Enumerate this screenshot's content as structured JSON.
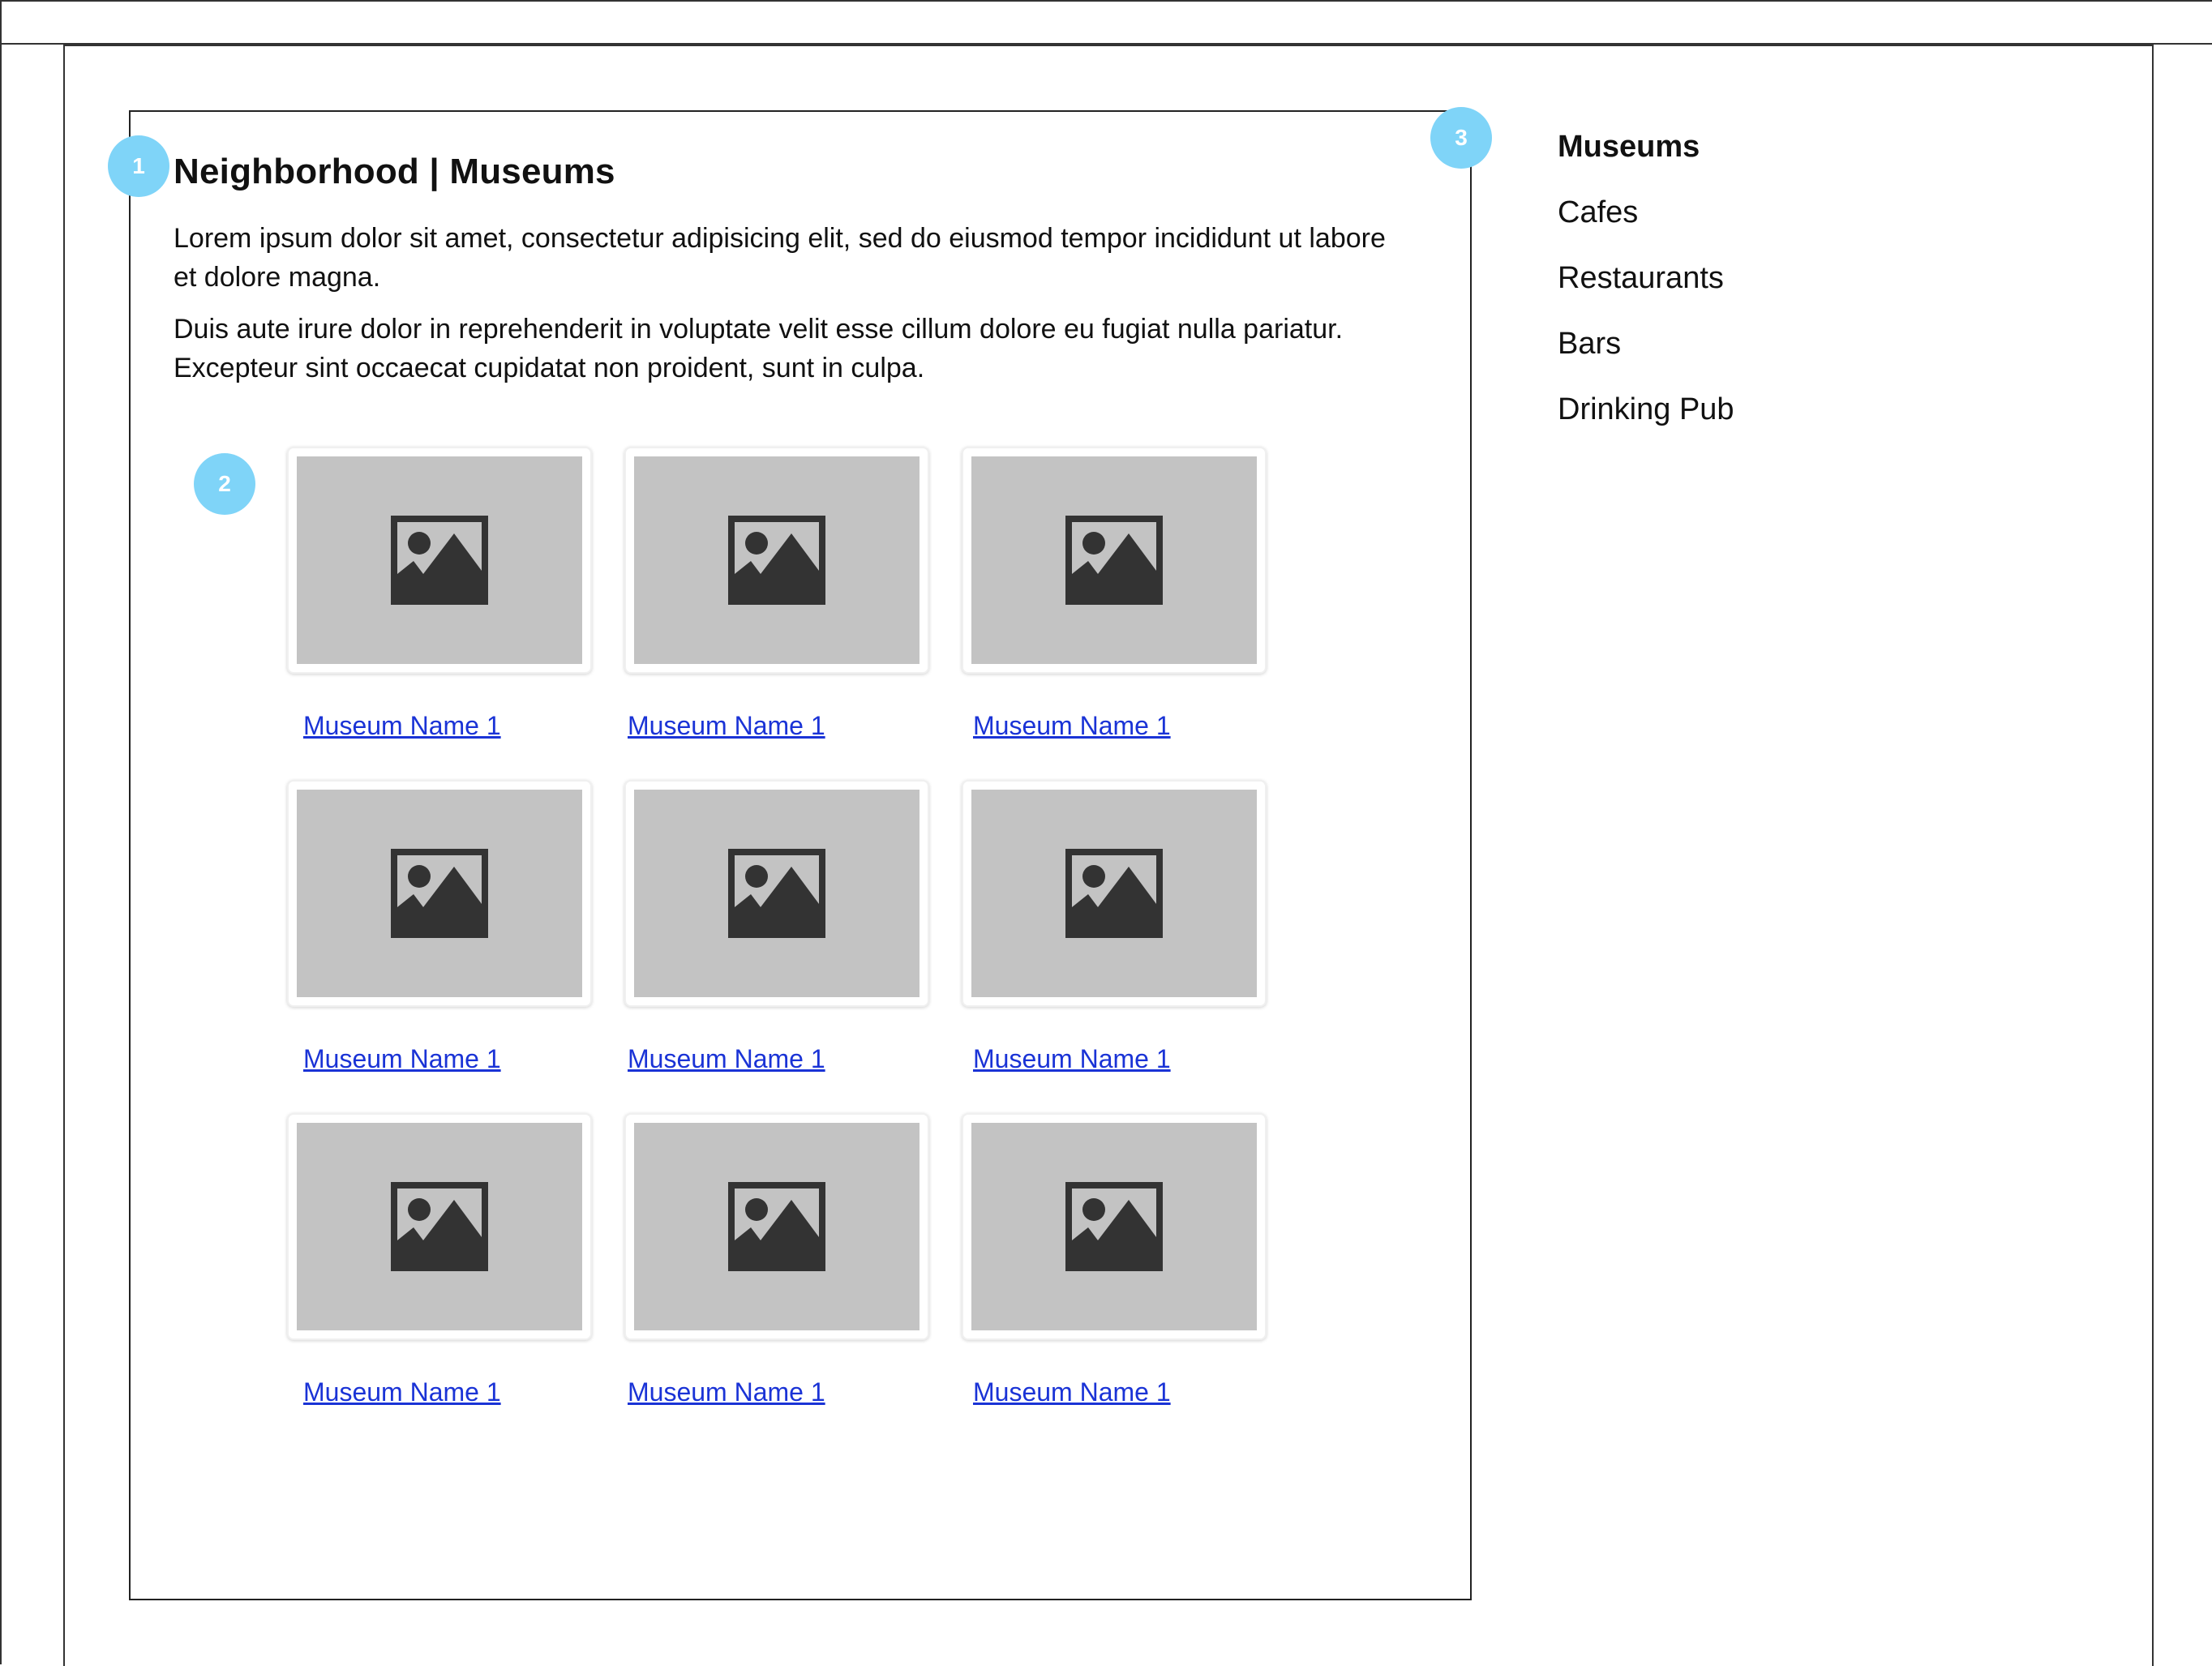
{
  "annotations": {
    "badge_1": "1",
    "badge_2": "2",
    "badge_3": "3"
  },
  "colors": {
    "badge": "#7fd4f8",
    "placeholder": "#c3c3c3",
    "link": "#1a33d6"
  },
  "main": {
    "title": "Neighborhood | Museums",
    "paragraphs": [
      "Lorem ipsum dolor sit amet, consectetur adipisicing elit, sed do eiusmod tempor incididunt ut labore et dolore magna.",
      "Duis aute irure dolor in reprehenderit in voluptate velit esse cillum dolore eu fugiat nulla pariatur. Excepteur sint occaecat cupidatat non proident, sunt in culpa."
    ],
    "cards": [
      {
        "label": "Museum Name 1",
        "icon": "image-placeholder-icon"
      },
      {
        "label": "Museum Name 1",
        "icon": "image-placeholder-icon"
      },
      {
        "label": "Museum Name 1",
        "icon": "image-placeholder-icon"
      },
      {
        "label": "Museum Name 1",
        "icon": "image-placeholder-icon"
      },
      {
        "label": "Museum Name 1",
        "icon": "image-placeholder-icon"
      },
      {
        "label": "Museum Name 1",
        "icon": "image-placeholder-icon"
      },
      {
        "label": "Museum Name 1",
        "icon": "image-placeholder-icon"
      },
      {
        "label": "Museum Name 1",
        "icon": "image-placeholder-icon"
      },
      {
        "label": "Museum Name 1",
        "icon": "image-placeholder-icon"
      }
    ]
  },
  "sidebar": {
    "items": [
      {
        "label": "Museums",
        "active": true
      },
      {
        "label": "Cafes",
        "active": false
      },
      {
        "label": "Restaurants",
        "active": false
      },
      {
        "label": "Bars",
        "active": false
      },
      {
        "label": "Drinking Pub",
        "active": false
      }
    ]
  }
}
